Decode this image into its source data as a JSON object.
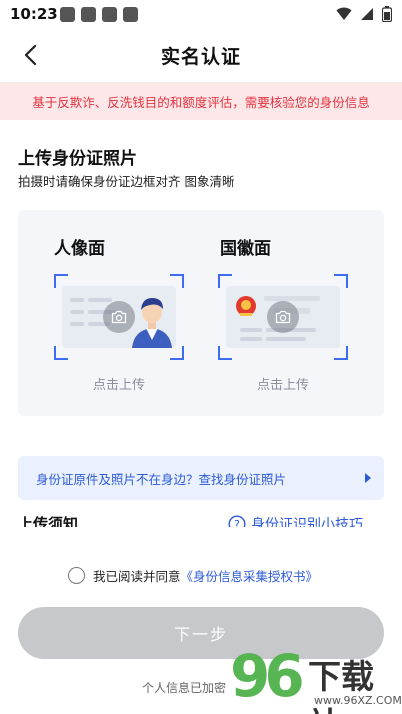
{
  "status_bar": {
    "time": "10:23"
  },
  "nav": {
    "title": "实名认证"
  },
  "notice": {
    "text": "基于反欺诈、反洗钱目的和额度评估，需要核验您的身份信息"
  },
  "upload_section": {
    "title": "上传身份证照片",
    "subtitle": "拍摄时请确保身份证边框对齐 图象清晰",
    "cards": [
      {
        "label": "人像面",
        "action": "点击上传"
      },
      {
        "label": "国徽面",
        "action": "点击上传"
      }
    ]
  },
  "tip_bar": {
    "text": "身份证原件及照片不在身边？查找身份证照片"
  },
  "notes": {
    "label": "上传须知",
    "tips_link": "身份证识别小技巧"
  },
  "agreement": {
    "prefix": "我已阅读并同意",
    "link": "《身份信息采集授权书》"
  },
  "next_button": {
    "label": "下一步"
  },
  "footer": {
    "note": "个人信息已加密"
  },
  "watermark": {
    "digits": "96",
    "brand": "下载站",
    "url": "www.96XZ.COM"
  },
  "colors": {
    "accent": "#3d6cf0",
    "link": "#2d5bd7",
    "notice_text": "#e2323f",
    "notice_bg": "#fde7e9",
    "button_disabled": "#c7c8cc"
  }
}
